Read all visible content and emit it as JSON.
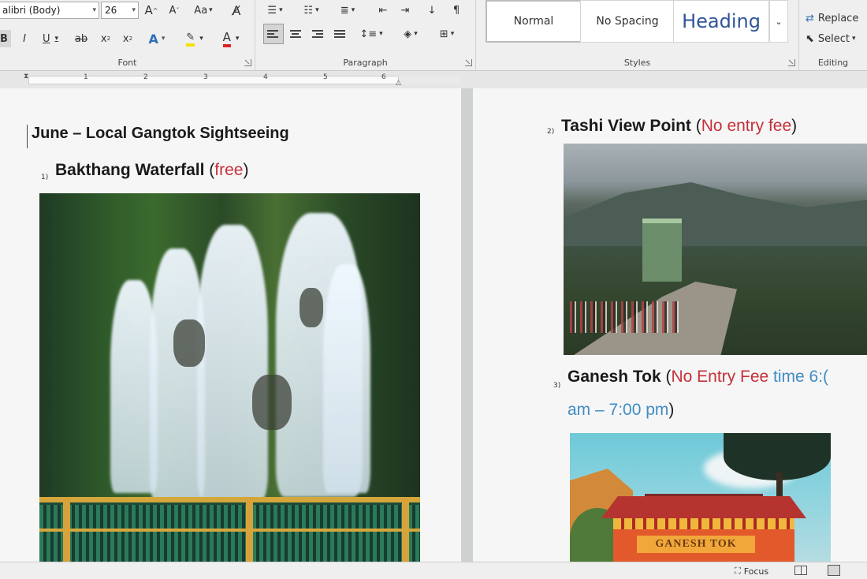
{
  "ribbon": {
    "font": {
      "font_name": "alibri (Body)",
      "font_size": "26",
      "grow_label": "A",
      "shrink_label": "A",
      "case_label": "Aa",
      "bold_label": "B",
      "italic_label": "I",
      "underline_label": "U",
      "strike_label": "ab",
      "subscript_label": "x",
      "superscript_label": "x",
      "effects_label": "A",
      "highlight_label": "ab",
      "color_label": "A",
      "group_label": "Font"
    },
    "paragraph": {
      "group_label": "Paragraph",
      "pilcrow": "¶"
    },
    "styles": {
      "items": [
        "Normal",
        "No Spacing",
        "Heading"
      ],
      "group_label": "Styles"
    },
    "editing": {
      "replace_label": "Replace",
      "select_label": "Select",
      "group_label": "Editing"
    }
  },
  "ruler": {
    "numbers": [
      "1",
      "2",
      "3",
      "4",
      "5",
      "6"
    ]
  },
  "document": {
    "page1": {
      "title": "June – Local Gangtok Sightseeing",
      "item1": {
        "number": "1)",
        "name": "Bakthang Waterfall",
        "open": " (",
        "fee": "free",
        "close": ")"
      }
    },
    "page2": {
      "item2": {
        "number": "2)",
        "name": "Tashi View Point",
        "open": " (",
        "fee": "No entry fee",
        "close": ")"
      },
      "item3": {
        "number": "3)",
        "name": "Ganesh Tok",
        "open": " (",
        "fee": "No Entry Fee",
        "time_start": " time 6:(",
        "time_end": "am – 7:00 pm",
        "close": ")"
      },
      "ganesh_sign": "GANESH TOK"
    }
  },
  "status": {
    "focus_label": "Focus"
  },
  "colors": {
    "fee_red": "#c5303a",
    "time_blue": "#3f8cc4"
  }
}
